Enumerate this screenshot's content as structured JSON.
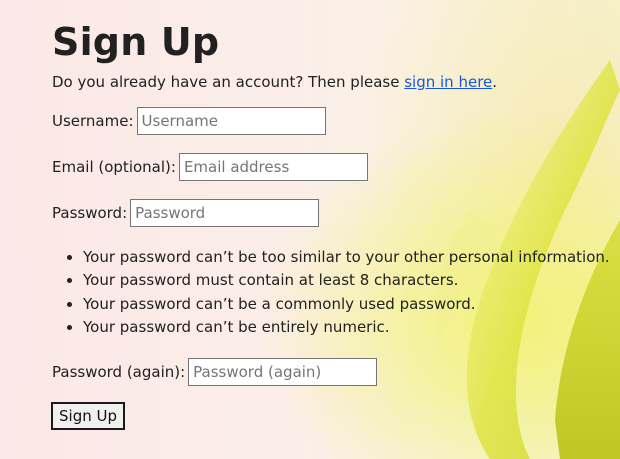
{
  "page": {
    "title": "Sign Up",
    "intro_text": "Do you already have an account? Then please ",
    "sign_in_link": "sign in here",
    "intro_end": "."
  },
  "form": {
    "username": {
      "label": "Username:",
      "placeholder": "Username",
      "value": ""
    },
    "email": {
      "label": "Email (optional):",
      "placeholder": "Email address",
      "value": ""
    },
    "password": {
      "label": "Password:",
      "placeholder": "Password",
      "value": ""
    },
    "password_help": [
      "Your password can’t be too similar to your other personal information.",
      "Your password must contain at least 8 characters.",
      "Your password can’t be a commonly used password.",
      "Your password can’t be entirely numeric."
    ],
    "password_again": {
      "label": "Password (again):",
      "placeholder": "Password (again)",
      "value": ""
    },
    "submit_label": "Sign Up"
  },
  "colors": {
    "link": "#1a57d6",
    "background_left": "#fbe8e6",
    "leaf_yellow": "#e6e94a"
  }
}
